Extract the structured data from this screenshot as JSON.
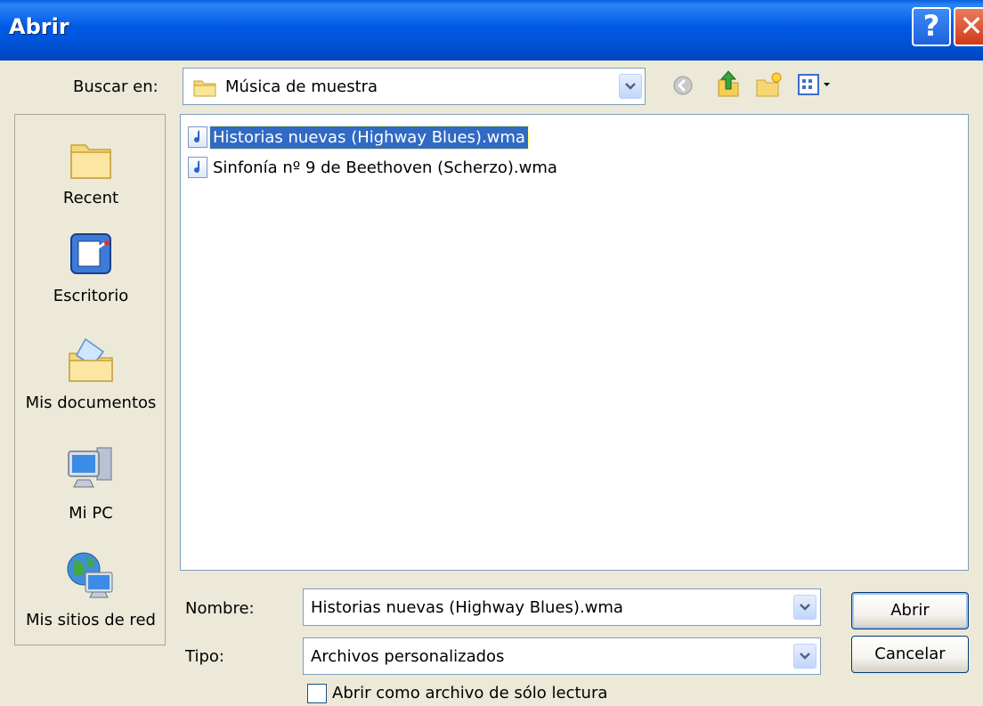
{
  "window": {
    "title": "Abrir"
  },
  "titlebar": {
    "help_glyph": "?",
    "close_glyph": "✕"
  },
  "lookin": {
    "label": "Buscar en:",
    "value": "Música de muestra"
  },
  "toolbar": {
    "icons": [
      "back-icon",
      "up-folder-icon",
      "new-folder-icon",
      "view-menu-icon"
    ]
  },
  "places": [
    {
      "label": "Recent",
      "icon": "recent-folder-icon"
    },
    {
      "label": "Escritorio",
      "icon": "desktop-icon"
    },
    {
      "label": "Mis documentos",
      "icon": "my-documents-icon"
    },
    {
      "label": "Mi PC",
      "icon": "my-computer-icon"
    },
    {
      "label": "Mis sitios de red",
      "icon": "network-places-icon"
    }
  ],
  "files": [
    {
      "name": "Historias nuevas (Highway Blues).wma",
      "selected": true
    },
    {
      "name": "Sinfonía nº 9 de Beethoven (Scherzo).wma",
      "selected": false
    }
  ],
  "filename": {
    "label": "Nombre:",
    "value": "Historias nuevas (Highway Blues).wma"
  },
  "filetype": {
    "label": "Tipo:",
    "value": "Archivos personalizados"
  },
  "readonly": {
    "label": "Abrir como archivo de sólo lectura",
    "checked": false
  },
  "buttons": {
    "open": "Abrir",
    "cancel": "Cancelar"
  },
  "colors": {
    "titlebar": "#0058e6",
    "selection": "#316ac5",
    "dialog_bg": "#ece9d8"
  }
}
